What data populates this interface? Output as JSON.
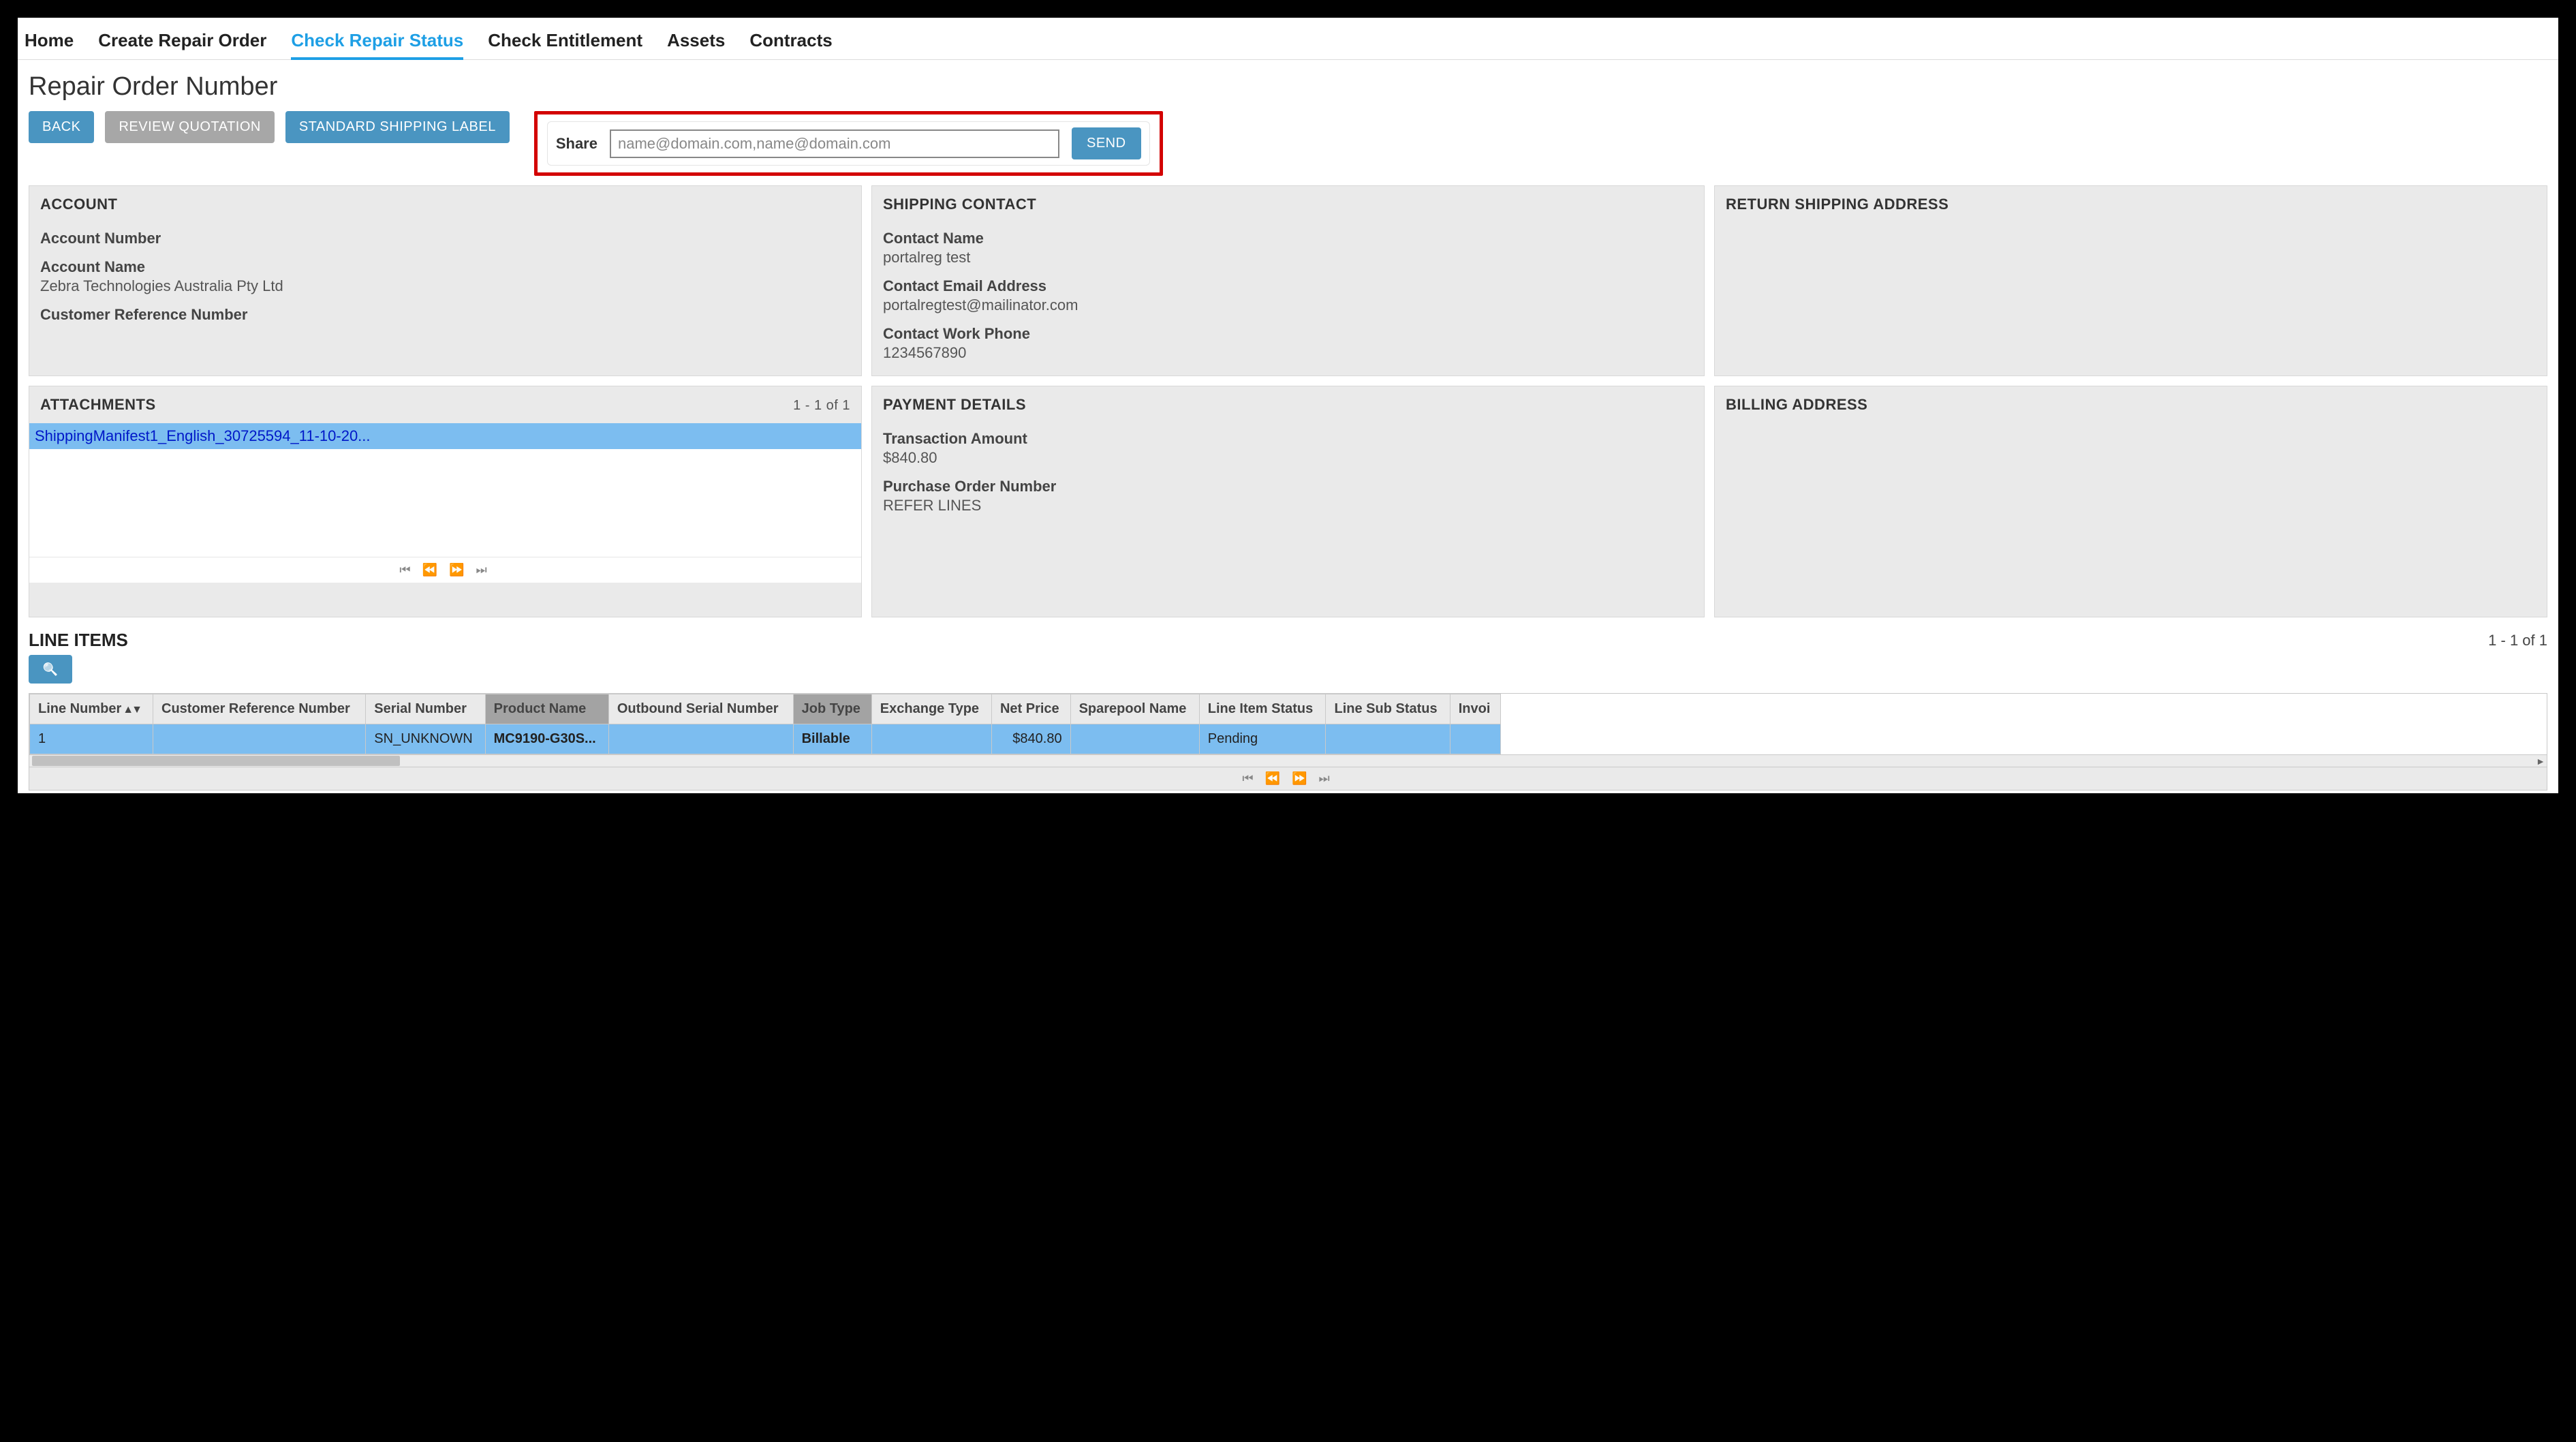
{
  "tabs": [
    "Home",
    "Create Repair Order",
    "Check Repair Status",
    "Check Entitlement",
    "Assets",
    "Contracts"
  ],
  "activeTabIndex": 2,
  "pageTitle": "Repair Order Number",
  "buttons": {
    "back": "BACK",
    "reviewQuotation": "REVIEW QUOTATION",
    "shippingLabel": "STANDARD SHIPPING LABEL",
    "send": "SEND"
  },
  "share": {
    "label": "Share",
    "placeholder": "name@domain.com,name@domain.com",
    "value": ""
  },
  "account": {
    "heading": "ACCOUNT",
    "numLabel": "Account Number",
    "numValue": "",
    "nameLabel": "Account Name",
    "nameValue": "Zebra Technologies Australia Pty Ltd",
    "refLabel": "Customer Reference Number",
    "refValue": ""
  },
  "shipping": {
    "heading": "SHIPPING CONTACT",
    "cnameLabel": "Contact Name",
    "cnameValue": "portalreg test",
    "cemailLabel": "Contact Email Address",
    "cemailValue": "portalregtest@mailinator.com",
    "cphoneLabel": "Contact Work Phone",
    "cphoneValue": "1234567890"
  },
  "returnShipping": {
    "heading": "RETURN SHIPPING ADDRESS"
  },
  "attachments": {
    "heading": "ATTACHMENTS",
    "range": "1 - 1 of 1",
    "item": "ShippingManifest1_English_30725594_11-10-20..."
  },
  "payment": {
    "heading": "PAYMENT DETAILS",
    "amtLabel": "Transaction Amount",
    "amtValue": "$840.80",
    "poLabel": "Purchase Order Number",
    "poValue": "REFER LINES"
  },
  "billing": {
    "heading": "BILLING ADDRESS"
  },
  "lineItems": {
    "heading": "LINE ITEMS",
    "range": "1 - 1 of 1",
    "columns": [
      "Line Number",
      "Customer Reference Number",
      "Serial Number",
      "Product Name",
      "Outbound Serial Number",
      "Job Type",
      "Exchange Type",
      "Net Price",
      "Sparepool Name",
      "Line Item Status",
      "Line Sub Status",
      "Invoi"
    ],
    "sortedCols": [
      3,
      5
    ],
    "row": {
      "lineNumber": "1",
      "custRef": "",
      "serial": "SN_UNKNOWN",
      "product": "MC9190-G30S...",
      "outboundSerial": "",
      "jobType": "Billable",
      "exchangeType": "",
      "netPrice": "$840.80",
      "sparepool": "",
      "status": "Pending",
      "subStatus": "",
      "invoice": ""
    }
  },
  "pagerGlyphs": {
    "first": "⏮",
    "prev": "⏪",
    "next": "⏩",
    "last": "⏭"
  }
}
